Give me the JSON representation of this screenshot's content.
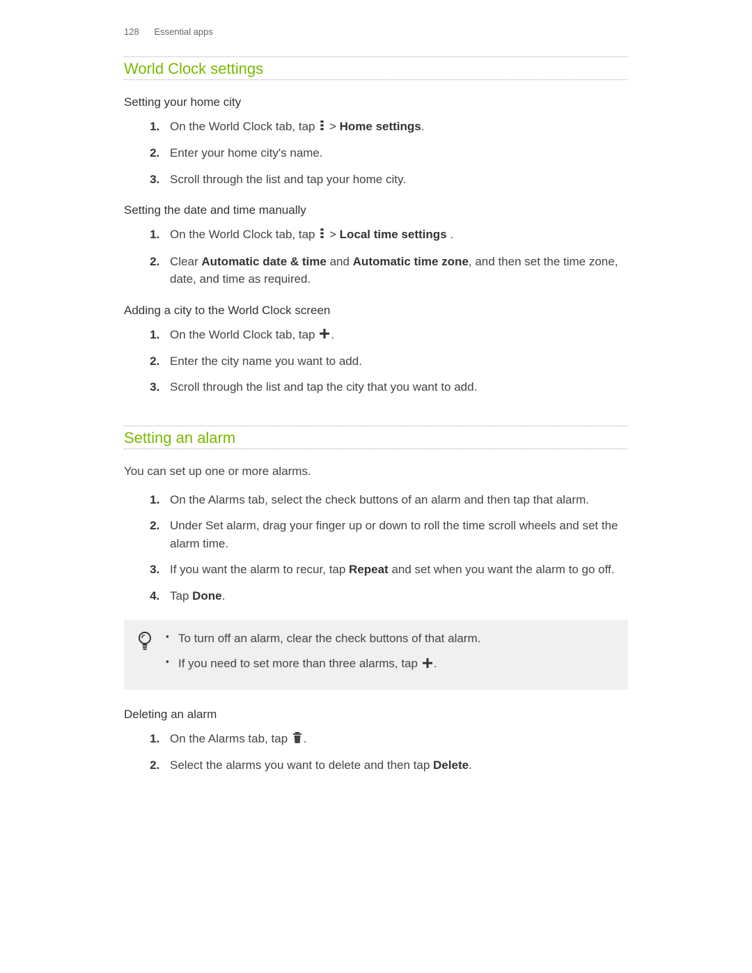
{
  "header": {
    "page_number": "128",
    "chapter": "Essential apps"
  },
  "sections": [
    {
      "title": "World Clock settings",
      "subsections": [
        {
          "heading": "Setting your home city",
          "steps": [
            {
              "pre": "On the World Clock tab, tap ",
              "icon": "menu",
              "post_gt": " > ",
              "bold": "Home settings",
              "tail": "."
            },
            {
              "plain": "Enter your home city's name."
            },
            {
              "plain": "Scroll through the list and tap your home city."
            }
          ]
        },
        {
          "heading": "Setting the date and time manually",
          "steps": [
            {
              "pre": "On the World Clock tab, tap ",
              "icon": "menu",
              "post_gt": " > ",
              "bold": "Local time settings",
              "tail": " ."
            },
            {
              "pre": "Clear ",
              "bold": "Automatic date & time",
              "mid": " and ",
              "bold2": "Automatic time zone",
              "tail": ", and then set the time zone, date, and time as required."
            }
          ]
        },
        {
          "heading": "Adding a city to the World Clock screen",
          "steps": [
            {
              "pre": "On the World Clock tab, tap ",
              "icon": "plus",
              "tail": "."
            },
            {
              "plain": "Enter the city name you want to add."
            },
            {
              "plain": "Scroll through the list and tap the city that you want to add."
            }
          ]
        }
      ]
    },
    {
      "title": "Setting an alarm",
      "intro": "You can set up one or more alarms.",
      "steps": [
        {
          "plain": "On the Alarms tab, select the check buttons of an alarm and then tap that alarm."
        },
        {
          "plain": "Under Set alarm, drag your finger up or down to roll the time scroll wheels and set the alarm time."
        },
        {
          "pre": "If you want the alarm to recur, tap ",
          "bold": "Repeat",
          "tail": " and set when you want the alarm to go off."
        },
        {
          "pre": "Tap ",
          "bold": "Done",
          "tail": "."
        }
      ],
      "tips": [
        {
          "plain": "To turn off an alarm, clear the check buttons of that alarm."
        },
        {
          "pre": "If you need to set more than three alarms, tap ",
          "icon": "plus",
          "tail": "."
        }
      ],
      "subsections": [
        {
          "heading": "Deleting an alarm",
          "steps": [
            {
              "pre": "On the Alarms tab, tap ",
              "icon": "trash",
              "tail": "."
            },
            {
              "pre": "Select the alarms you want to delete and then tap ",
              "bold": "Delete",
              "tail": "."
            }
          ]
        }
      ]
    }
  ]
}
